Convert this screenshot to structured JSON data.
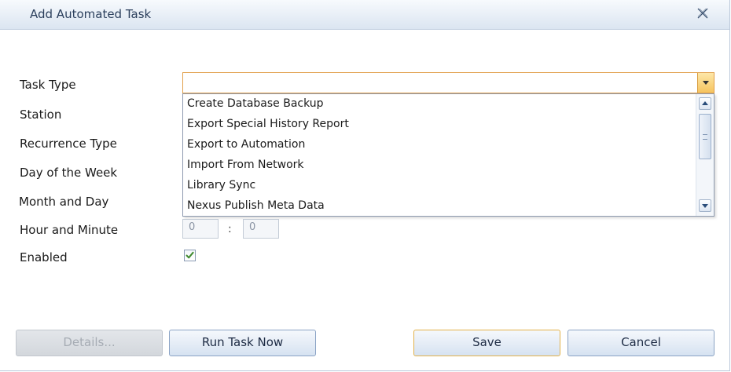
{
  "window": {
    "title": "Add Automated Task"
  },
  "form": {
    "labels": {
      "task_type": "Task Type",
      "station": "Station",
      "recurrence_type": "Recurrence Type",
      "day_of_week": "Day of the Week",
      "month_and_day": "Month and Day",
      "hour_and_minute": "Hour and Minute",
      "enabled": "Enabled"
    },
    "task_type_value": "",
    "task_type_options": [
      "Create Database Backup",
      "Export Special History Report",
      "Export to Automation",
      "Import From Network",
      "Library Sync",
      "Nexus Publish Meta Data"
    ],
    "hour_value": "0",
    "separator": ":",
    "minute_value": "0",
    "enabled_checked": true
  },
  "buttons": {
    "details": "Details...",
    "run_task_now": "Run Task Now",
    "save": "Save",
    "cancel": "Cancel"
  },
  "colors": {
    "accent_orange": "#e1a04b",
    "check_green": "#3f8a2e"
  }
}
